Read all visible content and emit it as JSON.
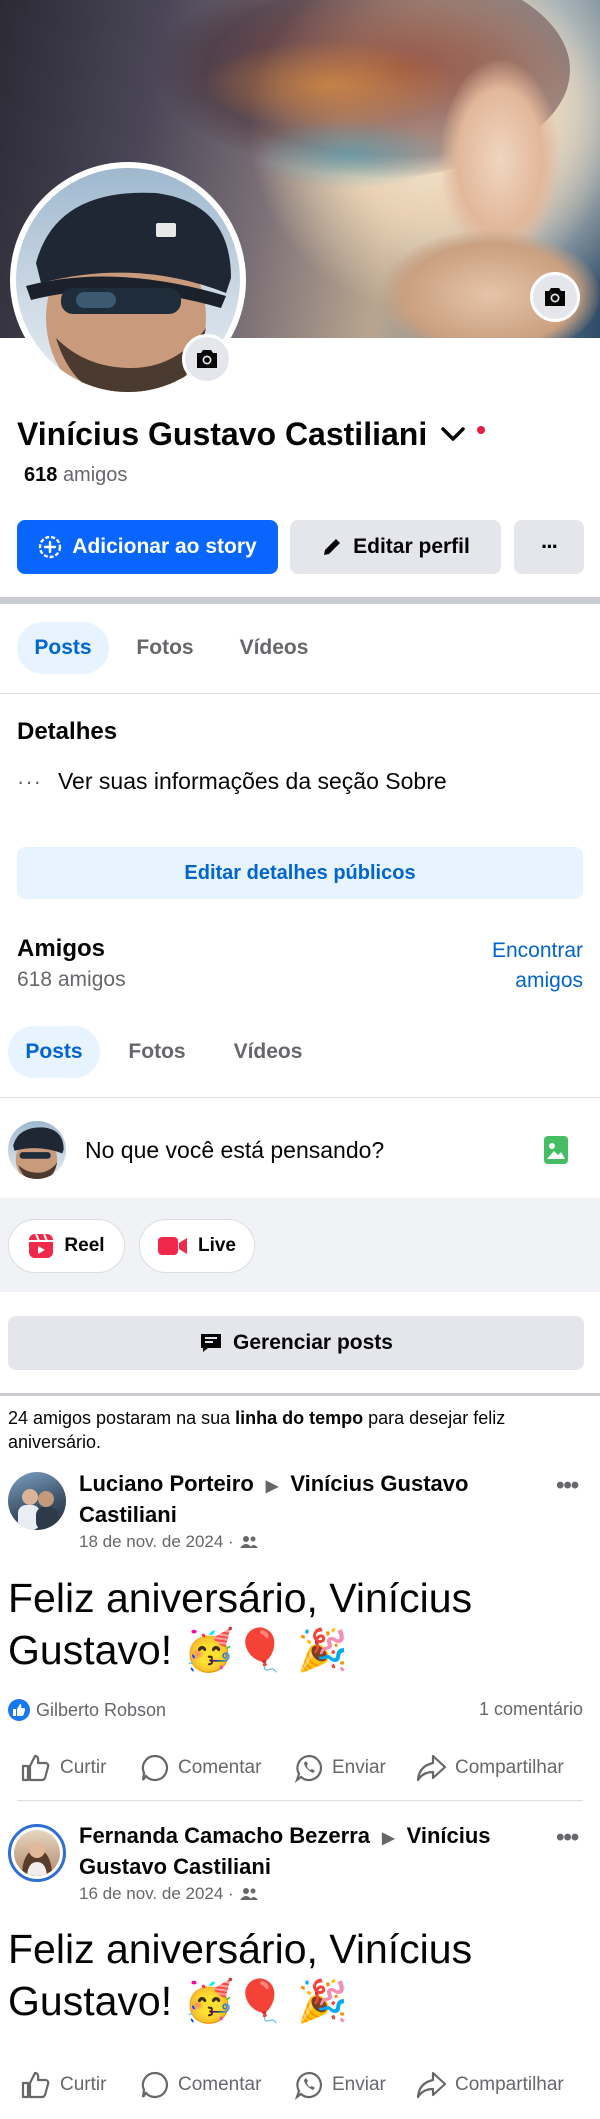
{
  "profile": {
    "name": "Vinícius Gustavo Castiliani",
    "friends_count": "618",
    "friends_label": "amigos"
  },
  "buttons": {
    "add_story": "Adicionar ao story",
    "edit_profile": "Editar perfil",
    "more": "···"
  },
  "tabs": [
    "Posts",
    "Fotos",
    "Vídeos"
  ],
  "details": {
    "title": "Detalhes",
    "about_link": "Ver suas informações da seção Sobre",
    "edit_public": "Editar detalhes públicos"
  },
  "friends_section": {
    "title": "Amigos",
    "count": "618 amigos",
    "find_line1": "Encontrar",
    "find_line2": "amigos"
  },
  "composer": {
    "placeholder": "No que você está pensando?",
    "reel": "Reel",
    "live": "Live",
    "manage_posts": "Gerenciar posts"
  },
  "birthday_notice": {
    "prefix": "24 amigos postaram na sua ",
    "bold": "linha do tempo",
    "suffix": " para desejar feliz aniversário."
  },
  "posts": [
    {
      "author": "Luciano Porteiro",
      "target_line1": "Vinícius Gustavo",
      "target_line2": "Castiliani",
      "date": "18 de nov. de 2024 ·",
      "text": "Feliz aniversário, Vinícius Gustavo! 🥳🎈 🎉",
      "reactor": "Gilberto Robson",
      "comments": "1 comentário"
    },
    {
      "author": "Fernanda Camacho Bezerra",
      "target_line1": "Vinícius",
      "target_line2": "Gustavo Castiliani",
      "date": "16 de nov. de 2024 ·",
      "text": "Feliz aniversário, Vinícius Gustavo! 🥳🎈 🎉"
    }
  ],
  "post_actions": {
    "like": "Curtir",
    "comment": "Comentar",
    "send": "Enviar",
    "share": "Compartilhar"
  },
  "colors": {
    "primary": "#0866ff",
    "link": "#0064d1",
    "secondary_bg": "#e4e6eb",
    "muted": "#65676b",
    "notify_dot": "#e41e3f"
  }
}
